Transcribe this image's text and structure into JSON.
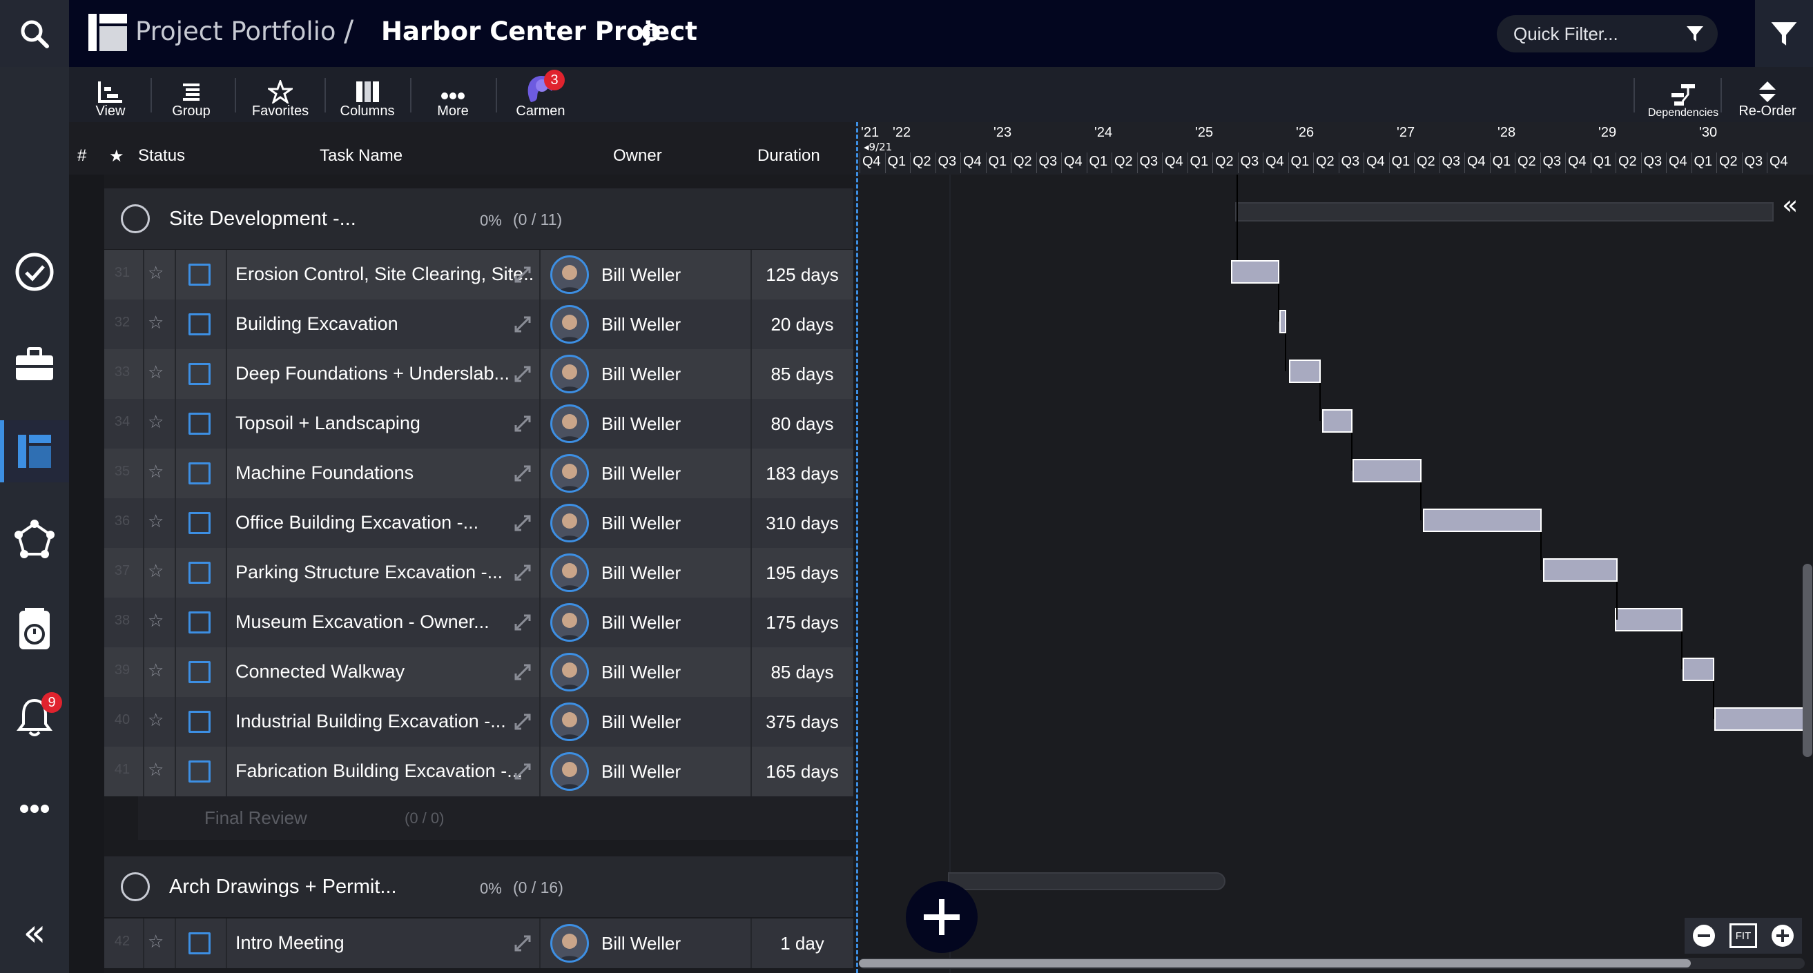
{
  "header": {
    "breadcrumb_root": "Project Portfolio",
    "breadcrumb_sep": "/",
    "project_title": "Harbor Center Project",
    "info_glyph": "i",
    "quick_filter_placeholder": "Quick Filter..."
  },
  "sidebar": {
    "notifications_count": "9",
    "collapse_glyph": "«"
  },
  "toolbar": {
    "view": "View",
    "group": "Group",
    "favorites": "Favorites",
    "columns": "Columns",
    "more": "More",
    "carmen": "Carmen",
    "carmen_badge": "3",
    "dependencies": "Dependencies",
    "reorder": "Re-Order"
  },
  "grid": {
    "columns": {
      "num": "#",
      "star": "★",
      "status": "Status",
      "task": "Task Name",
      "owner": "Owner",
      "duration": "Duration"
    },
    "groups": [
      {
        "name": "Site Development -...",
        "pct": "0%",
        "count": "(0 / 11)"
      },
      {
        "name": "Arch Drawings + Permit...",
        "pct": "0%",
        "count": "(0 / 16)"
      }
    ],
    "subgroup": {
      "name": "Final Review",
      "count": "(0 / 0)"
    },
    "rows": [
      {
        "num": "31",
        "task": "Erosion Control, Site Clearing, Site...",
        "owner": "Bill Weller",
        "duration": "125 days"
      },
      {
        "num": "32",
        "task": "Building Excavation",
        "owner": "Bill Weller",
        "duration": "20 days"
      },
      {
        "num": "33",
        "task": "Deep Foundations + Underslab...",
        "owner": "Bill Weller",
        "duration": "85 days"
      },
      {
        "num": "34",
        "task": "Topsoil + Landscaping",
        "owner": "Bill Weller",
        "duration": "80 days"
      },
      {
        "num": "35",
        "task": "Machine Foundations",
        "owner": "Bill Weller",
        "duration": "183 days"
      },
      {
        "num": "36",
        "task": "Office Building Excavation -...",
        "owner": "Bill Weller",
        "duration": "310 days"
      },
      {
        "num": "37",
        "task": "Parking Structure Excavation -...",
        "owner": "Bill Weller",
        "duration": "195 days"
      },
      {
        "num": "38",
        "task": "Museum Excavation - Owner...",
        "owner": "Bill Weller",
        "duration": "175 days"
      },
      {
        "num": "39",
        "task": "Connected Walkway",
        "owner": "Bill Weller",
        "duration": "85 days"
      },
      {
        "num": "40",
        "task": "Industrial Building Excavation -...",
        "owner": "Bill Weller",
        "duration": "375 days"
      },
      {
        "num": "41",
        "task": "Fabrication Building Excavation -...",
        "owner": "Bill Weller",
        "duration": "165 days"
      },
      {
        "num": "42",
        "task": "Intro Meeting",
        "owner": "Bill Weller",
        "duration": "1 day"
      }
    ]
  },
  "gantt": {
    "years": [
      "'21",
      "'22",
      "'23",
      "'24",
      "'25",
      "'26",
      "'27",
      "'28",
      "'29",
      "'30"
    ],
    "today_marker": "◂9/21",
    "quarters": [
      "Q4",
      "Q1",
      "Q2",
      "Q3",
      "Q4",
      "Q1",
      "Q2",
      "Q3",
      "Q4",
      "Q1",
      "Q2",
      "Q3",
      "Q4",
      "Q1",
      "Q2",
      "Q3",
      "Q4",
      "Q1",
      "Q2",
      "Q3",
      "Q4",
      "Q1",
      "Q2",
      "Q3",
      "Q4",
      "Q1",
      "Q2",
      "Q3",
      "Q4",
      "Q1",
      "Q2",
      "Q3",
      "Q4",
      "Q1",
      "Q2",
      "Q3",
      "Q4"
    ],
    "collapse_glyph": "«",
    "fit_label": "FIT"
  },
  "colors": {
    "accent": "#3d8fe3",
    "header_bg": "#03061f",
    "badge": "#e0232e",
    "bar": "#a8aac0"
  },
  "icons": [
    "search-icon",
    "filter-icon",
    "check-circle-icon",
    "briefcase-icon",
    "portfolio-icon",
    "network-icon",
    "timer-icon",
    "bell-icon",
    "more-icon",
    "collapse-icon",
    "view-icon",
    "group-icon",
    "star-icon",
    "columns-icon",
    "ellipsis-icon",
    "carmen-icon",
    "dependencies-icon",
    "reorder-icon",
    "expand-icon",
    "add-icon",
    "zoom-out-icon",
    "zoom-in-icon",
    "fit-icon"
  ]
}
